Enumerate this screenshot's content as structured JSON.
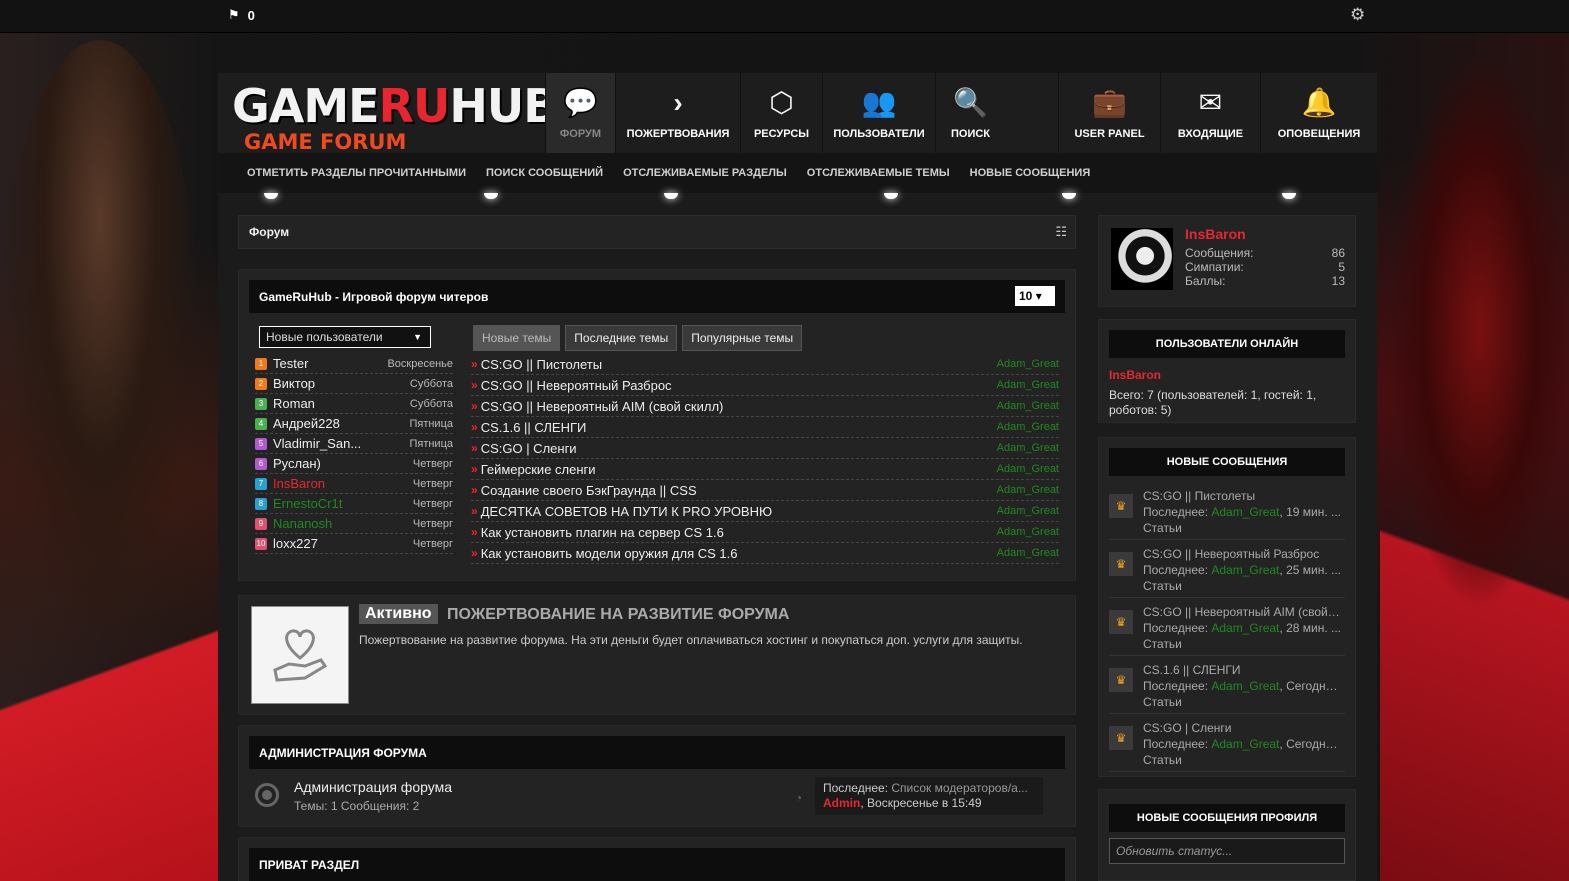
{
  "topbar": {
    "count": "0"
  },
  "logo": {
    "line1_a": "GAME",
    "line1_b": "RU",
    "line1_c": "HUB",
    "line2": "GAME FORUM"
  },
  "nav": [
    {
      "label": "Форум",
      "icon": "chat-icon",
      "glyph": "💬"
    },
    {
      "label": "Пожертвования",
      "icon": "chevron-right-icon",
      "glyph": "›"
    },
    {
      "label": "Ресурсы",
      "icon": "cubes-icon",
      "glyph": "⬡"
    },
    {
      "label": "Пользователи",
      "icon": "users-icon",
      "glyph": "👥"
    },
    {
      "label": "Поиск",
      "icon": "search-icon",
      "glyph": "🔍"
    },
    {
      "label": "User Panel",
      "icon": "briefcase-icon",
      "glyph": "💼"
    },
    {
      "label": "Входящие",
      "icon": "envelope-icon",
      "glyph": "✉"
    },
    {
      "label": "Оповещения",
      "icon": "bell-icon",
      "glyph": "🔔"
    }
  ],
  "subnav": [
    "Отметить разделы прочитанными",
    "Поиск сообщений",
    "Отслеживаемые разделы",
    "Отслеживаемые темы",
    "Новые сообщения"
  ],
  "breadcrumb": "Форум",
  "main_block": {
    "title": "GameRuHub - Игровой форум читеров",
    "select_value": "10",
    "users_dropdown": "Новые пользователи",
    "users": [
      {
        "n": "1",
        "name": "Tester",
        "day": "Воскресенье",
        "color": "#f07a1a",
        "name_color": "#eee"
      },
      {
        "n": "2",
        "name": "Виктор",
        "day": "Суббота",
        "color": "#f07a1a",
        "name_color": "#eee"
      },
      {
        "n": "3",
        "name": "Roman",
        "day": "Суббота",
        "color": "#4caf50",
        "name_color": "#eee"
      },
      {
        "n": "4",
        "name": "Андрей228",
        "day": "Пятница",
        "color": "#4caf50",
        "name_color": "#eee"
      },
      {
        "n": "5",
        "name": "Vladimir_San...",
        "day": "Пятница",
        "color": "#b05ad0",
        "name_color": "#eee"
      },
      {
        "n": "6",
        "name": "Руслан)",
        "day": "Четверг",
        "color": "#b05ad0",
        "name_color": "#eee"
      },
      {
        "n": "7",
        "name": "InsBaron",
        "day": "Четверг",
        "color": "#2aa0d0",
        "name_color": "#e8262f"
      },
      {
        "n": "8",
        "name": "ErnestoCr1t",
        "day": "Четверг",
        "color": "#2aa0d0",
        "name_color": "#1f8a1f"
      },
      {
        "n": "9",
        "name": "Nananosh",
        "day": "Четверг",
        "color": "#e05070",
        "name_color": "#1f8a1f"
      },
      {
        "n": "10",
        "name": "loxx227",
        "day": "Четверг",
        "color": "#e05070",
        "name_color": "#eee"
      }
    ],
    "tabs": [
      "Новые темы",
      "Последние темы",
      "Популярные темы"
    ],
    "threads": [
      {
        "title": "CS:GO || Пистолеты",
        "author": "Adam_Great"
      },
      {
        "title": "CS:GO || Невероятный Разброс",
        "author": "Adam_Great"
      },
      {
        "title": "CS:GO || Невероятный AIM (свой скилл)",
        "author": "Adam_Great"
      },
      {
        "title": "CS.1.6 || СЛЕНГИ",
        "author": "Adam_Great"
      },
      {
        "title": "CS:GO | Сленги",
        "author": "Adam_Great"
      },
      {
        "title": "Геймерские сленги",
        "author": "Adam_Great"
      },
      {
        "title": "Создание своего БэкГраунда || CSS",
        "author": "Adam_Great"
      },
      {
        "title": "ДЕСЯТКА СОВЕТОВ НА ПУТИ К PRO УРОВНЮ",
        "author": "Adam_Great"
      },
      {
        "title": "Как установить плагин на сервер CS 1.6",
        "author": "Adam_Great"
      },
      {
        "title": "Как установить модели оружия для CS 1.6",
        "author": "Adam_Great"
      }
    ]
  },
  "donate": {
    "badge": "Активно",
    "title": "Пожертвование на развитие форума",
    "desc": "Пожертвование на развитие форума. На эти деньги будет оплачиваться хостинг и покупаться доп. услуги для защиты."
  },
  "admin_section": {
    "head": "АДМИНИСТРАЦИЯ ФОРУМА",
    "forum_name": "Администрация форума",
    "stats": "Темы: 1   Сообщения: 2",
    "last_label": "Последнее:",
    "last_title": "Список модераторов/а...",
    "last_user": "Admin",
    "last_date": ", Воскресенье в 15:49"
  },
  "private_section": {
    "head": "ПРИВАТ РАЗДЕЛ"
  },
  "profile": {
    "name": "InsBaron",
    "stats": [
      {
        "label": "Сообщения:",
        "value": "86"
      },
      {
        "label": "Симпатии:",
        "value": "5"
      },
      {
        "label": "Баллы:",
        "value": "13"
      }
    ]
  },
  "online": {
    "head": "Пользователи онлайн",
    "user": "InsBaron",
    "summary": "Всего: 7 (пользователей: 1, гостей: 1, роботов: 5)"
  },
  "new_messages": {
    "head": "Новые сообщения",
    "items": [
      {
        "title": "CS:GO || Пистолеты",
        "user": "Adam_Great",
        "time": ", 19 мин. ...",
        "cat": "Статьи"
      },
      {
        "title": "CS:GO || Невероятный Разброс",
        "user": "Adam_Great",
        "time": ", 25 мин. ...",
        "cat": "Статьи"
      },
      {
        "title": "CS:GO || Невероятный AIM (свой с...",
        "user": "Adam_Great",
        "time": ", 28 мин. ...",
        "cat": "Статьи"
      },
      {
        "title": "CS.1.6 || СЛЕНГИ",
        "user": "Adam_Great",
        "time": ", Сегодня,...",
        "cat": "Статьи"
      },
      {
        "title": "CS:GO | Сленги",
        "user": "Adam_Great",
        "time": ", Сегодня,...",
        "cat": "Статьи"
      }
    ],
    "last_prefix": "Последнее: "
  },
  "profile_posts": {
    "head": "Новые сообщения профиля",
    "placeholder": "Обновить статус..."
  },
  "colors": {
    "accent": "#e8262f",
    "green": "#1f8a1f",
    "bg": "#1b1b1b"
  }
}
